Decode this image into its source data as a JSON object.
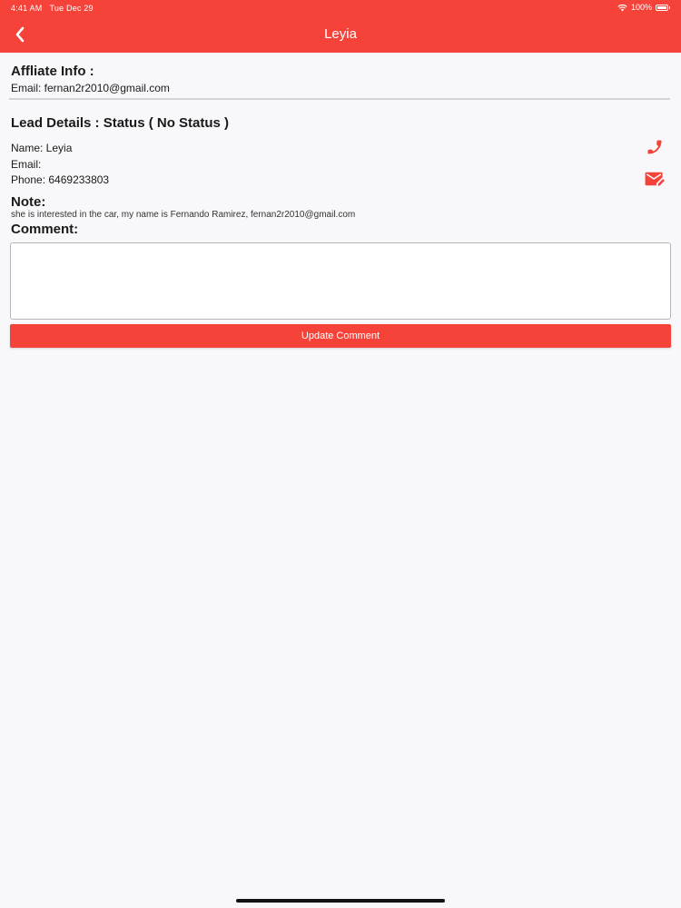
{
  "status_bar": {
    "time": "4:41 AM",
    "date": "Tue Dec 29",
    "battery": "100%",
    "battery_level": 1.0
  },
  "nav": {
    "title": "Leyia",
    "back_icon": "chevron-left-icon"
  },
  "affiliate": {
    "title": "Affliate Info :",
    "email": "Email: fernan2r2010@gmail.com"
  },
  "lead": {
    "title": "Lead Details : Status ( No Status )",
    "name": "Name: Leyia",
    "email": "Email:",
    "phone": "Phone: 6469233803"
  },
  "note": {
    "title": "Note:",
    "text": "she is interested in the car, my name is Fernando Ramirez, fernan2r2010@gmail.com"
  },
  "comment": {
    "title": "Comment:",
    "value": "",
    "button_label": "Update Comment"
  },
  "icons": {
    "phone": "phone-icon",
    "email": "email-edit-icon"
  },
  "colors": {
    "accent": "#f5433a",
    "background": "#f8f8fa"
  }
}
